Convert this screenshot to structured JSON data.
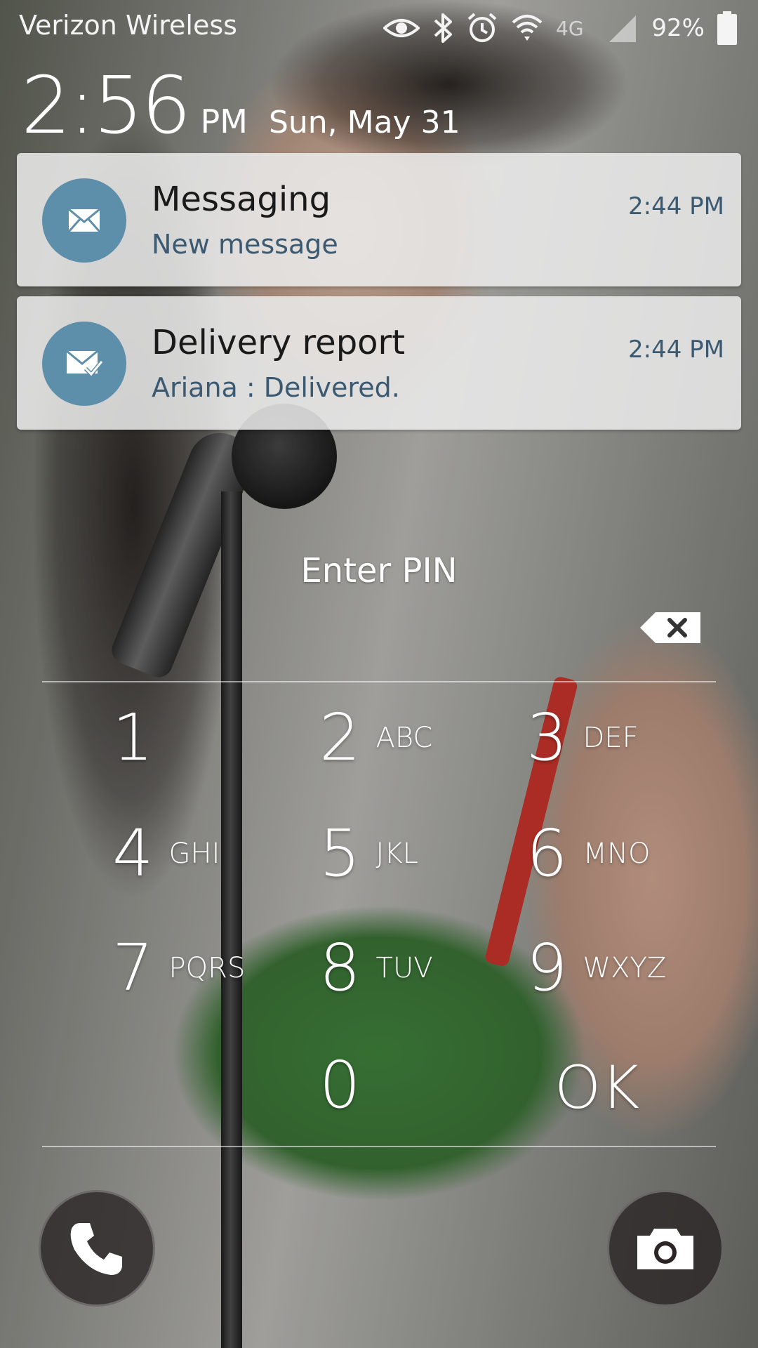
{
  "status_bar": {
    "carrier": "Verizon Wireless",
    "network": "4G",
    "battery_percent": "92%",
    "icons": [
      "eye-icon",
      "bluetooth-icon",
      "alarm-icon",
      "wifi-icon",
      "lte-icon",
      "signal-icon",
      "battery-icon"
    ]
  },
  "clock": {
    "time": "2:56",
    "ampm": "PM",
    "date": "Sun, May 31"
  },
  "notifications": [
    {
      "app": "Messaging",
      "text": "New message",
      "time": "2:44 PM",
      "icon": "message-icon"
    },
    {
      "app": "Delivery report",
      "text": "Ariana : Delivered.",
      "time": "2:44 PM",
      "icon": "delivered-icon"
    }
  ],
  "pin": {
    "prompt": "Enter PIN",
    "ok_label": "OK"
  },
  "keypad": [
    {
      "digit": "1",
      "letters": ""
    },
    {
      "digit": "2",
      "letters": "ABC"
    },
    {
      "digit": "3",
      "letters": "DEF"
    },
    {
      "digit": "4",
      "letters": "GHI"
    },
    {
      "digit": "5",
      "letters": "JKL"
    },
    {
      "digit": "6",
      "letters": "MNO"
    },
    {
      "digit": "7",
      "letters": "PQRS"
    },
    {
      "digit": "8",
      "letters": "TUV"
    },
    {
      "digit": "9",
      "letters": "WXYZ"
    },
    {
      "digit": "0",
      "letters": ""
    }
  ],
  "shortcuts": [
    "phone-icon",
    "camera-icon"
  ],
  "colors": {
    "notification_icon_bg": "#5d8fab",
    "notification_subtext": "#3b5a72"
  }
}
